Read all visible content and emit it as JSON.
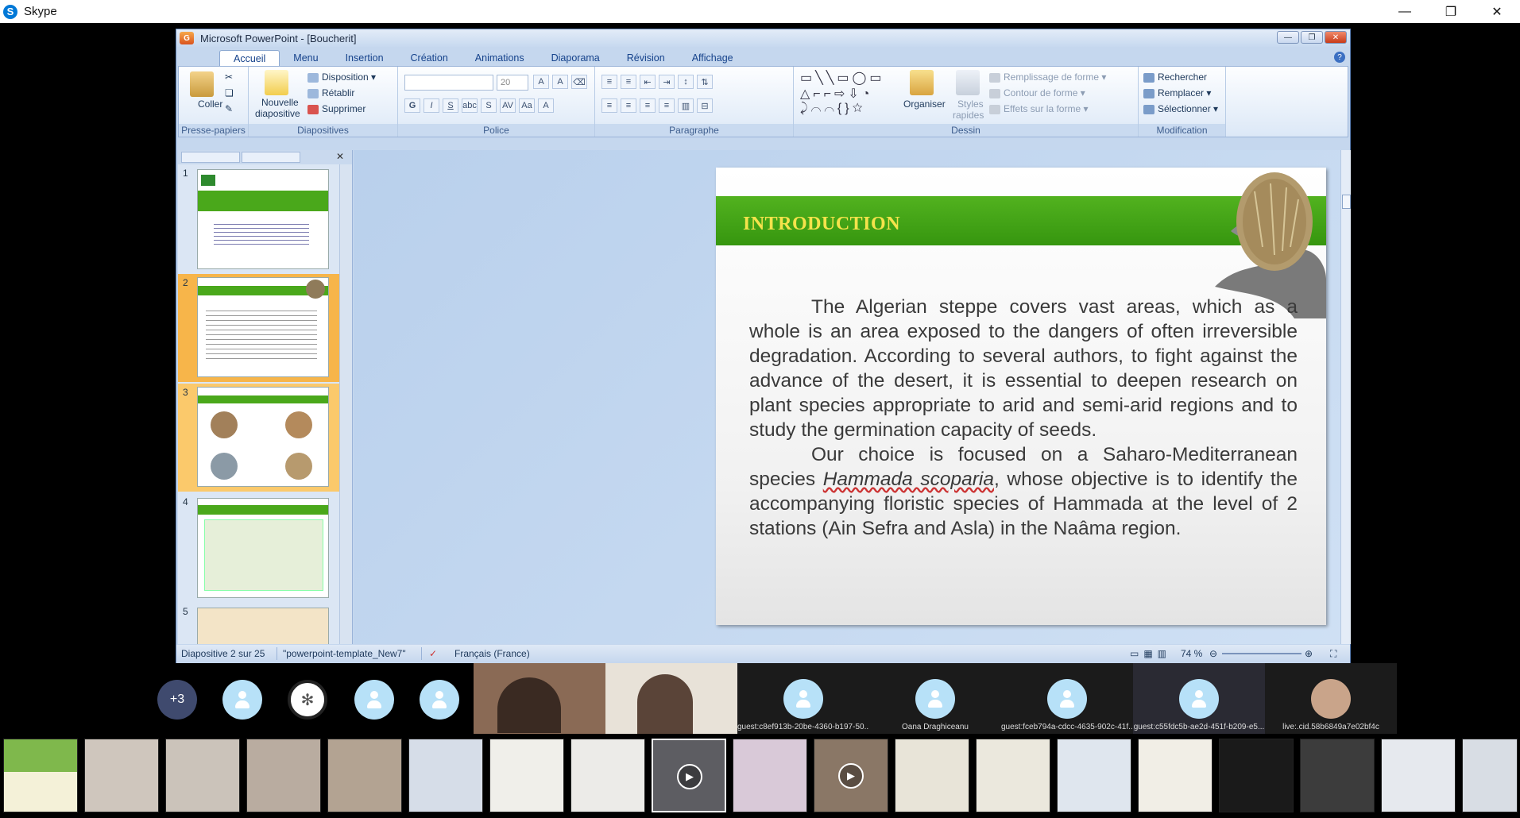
{
  "skype": {
    "title": "Skype",
    "logo_letter": "S",
    "minimize": "—",
    "restore": "❐",
    "close": "✕"
  },
  "ppt": {
    "window_title": "Microsoft PowerPoint - [Boucherit]",
    "office_icon": "G",
    "tabs": [
      "Accueil",
      "Menu",
      "Insertion",
      "Création",
      "Animations",
      "Diaporama",
      "Révision",
      "Affichage"
    ],
    "active_tab": "Accueil",
    "help_icon": "?",
    "ribbon": {
      "clipboard": {
        "paste": "Coller",
        "label": "Presse-papiers"
      },
      "slides": {
        "new_slide": "Nouvelle",
        "new_slide2": "diapositive",
        "layout": "Disposition",
        "reset": "Rétablir",
        "delete": "Supprimer",
        "label": "Diapositives"
      },
      "font": {
        "font_name": "",
        "font_size": "20",
        "label": "Police"
      },
      "paragraph": {
        "label": "Paragraphe"
      },
      "drawing": {
        "arrange": "Organiser",
        "quick_styles": "Styles",
        "quick_styles2": "rapides",
        "fill": "Remplissage de forme",
        "outline": "Contour de forme",
        "effects": "Effets sur la forme",
        "label": "Dessin"
      },
      "editing": {
        "find": "Rechercher",
        "replace": "Remplacer",
        "select": "Sélectionner",
        "label": "Modification"
      }
    },
    "thumbnails": [
      {
        "num": "1"
      },
      {
        "num": "2"
      },
      {
        "num": "3"
      },
      {
        "num": "4"
      },
      {
        "num": "5"
      }
    ],
    "slide": {
      "title": "INTRODUCTION",
      "para1": "The Algerian steppe covers vast areas, which as a whole is an area exposed to the dangers of often irreversible degradation. According to several authors, to fight against the advance of the desert, it is essential to deepen research on plant species appropriate to arid and semi-arid regions and to study the germination capacity of seeds.",
      "para2_a": "Our choice is focused on a Saharo-Mediterranean species ",
      "para2_species": "Hammada scoparia",
      "para2_b": ", whose objective is to identify the accompanying floristic species of Hammada at the level of 2 stations (Ain Sefra and Asla) in the Naâma region."
    },
    "status": {
      "slide_counter": "Diapositive 2 sur 25",
      "theme": "\"powerpoint-template_New7\"",
      "language": "Français (France)",
      "zoom": "74 %"
    }
  },
  "participants": {
    "more_count": "+3",
    "tiles": [
      {
        "name": "guest:c8ef913b-20be-4360-b197-50..."
      },
      {
        "name": "Oana Draghiceanu"
      },
      {
        "name": "guest:fceb794a-cdcc-4635-902c-41f..."
      },
      {
        "name": "guest:c55fdc5b-ae2d-451f-b209-e5..."
      },
      {
        "name": "live:.cid.58b6849a7e02bf4c"
      }
    ]
  }
}
